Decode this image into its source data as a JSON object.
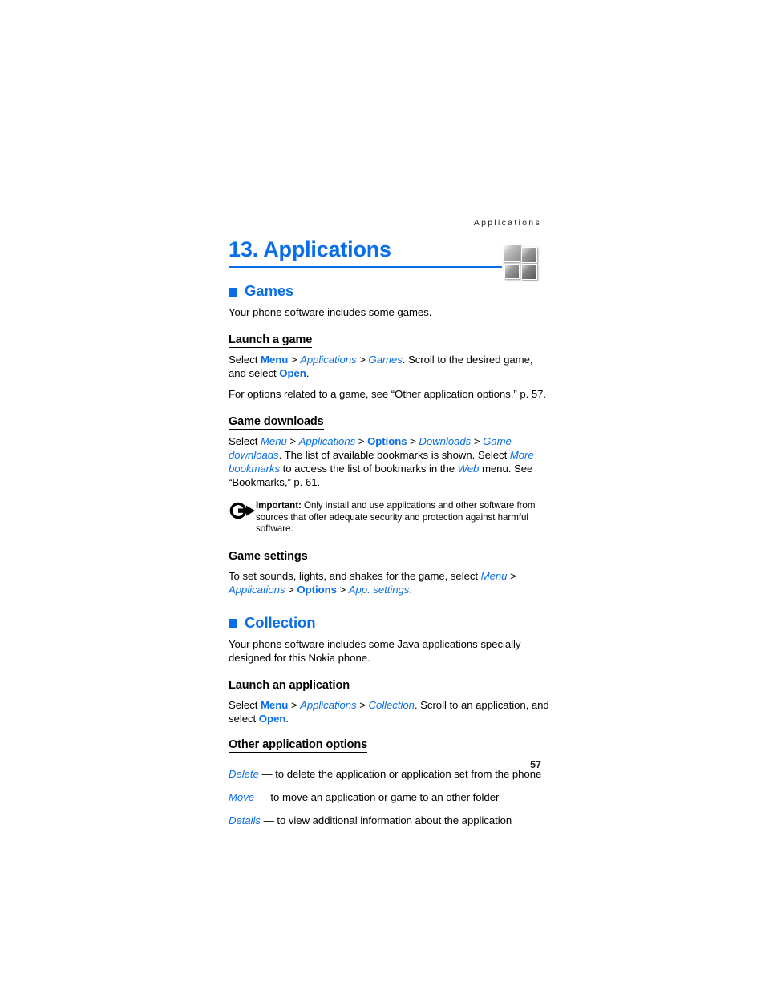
{
  "page": {
    "running_header": "Applications",
    "page_number": "57"
  },
  "chapter": {
    "title": "13. Applications",
    "icon": "app-grid-icon",
    "accent_color": "#0a6ee8"
  },
  "sections": [
    {
      "id": "games",
      "heading": "Games",
      "intro": "Your phone software includes some games.",
      "subsections": [
        {
          "id": "launch-a-game",
          "heading": "Launch a game",
          "paragraph_1": {
            "t1": "Select ",
            "menu": "Menu",
            "s1": " > ",
            "applications": "Applications",
            "s2": " > ",
            "games": "Games",
            "t2": ". Scroll to the desired game, and select ",
            "open": "Open",
            "t3": "."
          },
          "paragraph_2": "For options related to a game, see “Other application options,” p. 57."
        },
        {
          "id": "game-downloads",
          "heading": "Game downloads",
          "paragraph_1": {
            "t1": "Select ",
            "menu": "Menu",
            "s1": " > ",
            "applications": "Applications",
            "s2": " > ",
            "options": "Options",
            "s3": " > ",
            "downloads": "Downloads",
            "s4": " > ",
            "game_downloads": "Game downloads",
            "t2": ". The list of available bookmarks is shown. Select ",
            "more_bookmarks": "More bookmarks",
            "t3": " to access the list of bookmarks in the ",
            "web": "Web",
            "t4": " menu. See “Bookmarks,” p. 61."
          },
          "note": {
            "icon": "important-arrow-icon",
            "lead": "Important:",
            "text": " Only install and use applications and other software from sources that offer adequate security and protection against harmful software."
          }
        },
        {
          "id": "game-settings",
          "heading": "Game settings",
          "paragraph_1": {
            "t1": "To set sounds, lights, and shakes for the game, select ",
            "menu": "Menu",
            "s1": " > ",
            "applications": "Applications",
            "s2": " > ",
            "options": "Options",
            "s3": " > ",
            "app_settings": "App. settings",
            "t2": "."
          }
        }
      ]
    },
    {
      "id": "collection",
      "heading": "Collection",
      "intro": "Your phone software includes some Java applications specially designed for this Nokia phone.",
      "subsections": [
        {
          "id": "launch-an-application",
          "heading": "Launch an application",
          "paragraph_1": {
            "t1": "Select ",
            "menu": "Menu",
            "s1": " > ",
            "applications": "Applications",
            "s2": " > ",
            "collection": "Collection",
            "t2": ". Scroll to an application, and select ",
            "open": "Open",
            "t3": "."
          }
        },
        {
          "id": "other-application-options",
          "heading": "Other application options",
          "options": [
            {
              "term": "Delete",
              "desc": " — to delete the application or application set from the phone"
            },
            {
              "term": "Move",
              "desc": " — to move an application or game to an other folder"
            },
            {
              "term": "Details",
              "desc": " — to view additional information about the application"
            }
          ]
        }
      ]
    }
  ]
}
